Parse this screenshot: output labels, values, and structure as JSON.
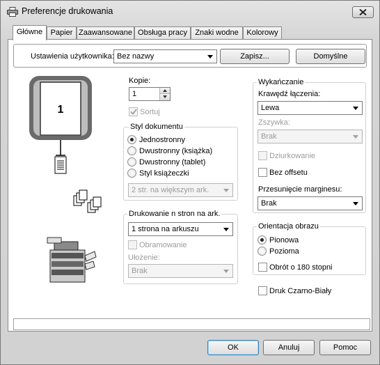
{
  "window": {
    "title": "Preferencje drukowania"
  },
  "tabs": [
    {
      "label": "Główne",
      "active": true
    },
    {
      "label": "Papier"
    },
    {
      "label": "Zaawansowane"
    },
    {
      "label": "Obsługa pracy"
    },
    {
      "label": "Znaki wodne"
    },
    {
      "label": "Kolorowy"
    }
  ],
  "user_settings": {
    "label": "Ustawienia użytkownika:",
    "value": "Bez nazwy",
    "save_label": "Zapisz...",
    "defaults_label": "Domyślne"
  },
  "preview": {
    "page_number": "1"
  },
  "copies": {
    "label": "Kopie:",
    "value": "1",
    "sort_label": "Sortuj",
    "sort_checked": true
  },
  "document_style": {
    "title": "Styl dokumentu",
    "options": [
      "Jednostronny",
      "Dwustronny (książka)",
      "Dwustronny (tablet)",
      "Styl książeczki"
    ],
    "selected": 0,
    "booklet_value": "2 str. na większym ark."
  },
  "nup": {
    "title": "Drukowanie n stron na ark.",
    "value": "1 strona na arkuszu",
    "border_label": "Obramowanie",
    "order_label": "Ułożenie:",
    "order_value": "Brak"
  },
  "finishing": {
    "title": "Wykańczanie",
    "binding_label": "Krawędź łączenia:",
    "binding_value": "Lewa",
    "staple_label": "Zszywka:",
    "staple_value": "Brak",
    "punch_label": "Dziurkowanie",
    "offset_label": "Bez offsetu",
    "margin_label": "Przesunięcie marginesu:",
    "margin_value": "Brak"
  },
  "orientation": {
    "title": "Orientacja obrazu",
    "options": [
      "Pionowa",
      "Pozioma"
    ],
    "selected": 0,
    "rotate_label": "Obrót o 180 stopni"
  },
  "bw_label": "Druk Czarno-Biały",
  "footer": {
    "ok": "OK",
    "cancel": "Anuluj",
    "help": "Pomoc"
  }
}
